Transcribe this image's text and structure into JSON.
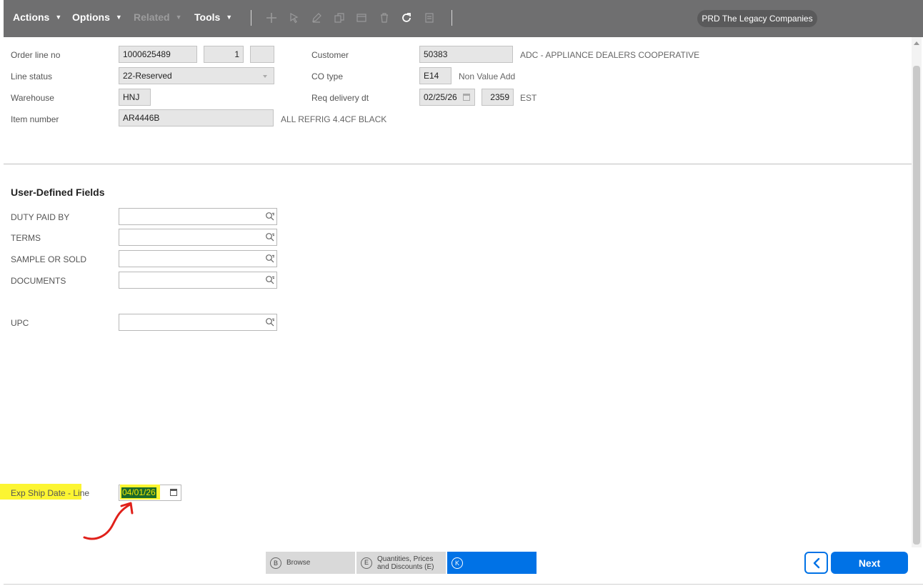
{
  "toolbar": {
    "actions": "Actions",
    "options": "Options",
    "related": "Related",
    "tools": "Tools",
    "company": "PRD The Legacy Companies",
    "icons": [
      "add-icon",
      "select-icon",
      "edit-icon",
      "copy-icon",
      "save-icon",
      "delete-icon",
      "refresh-icon",
      "notes-icon"
    ]
  },
  "header": {
    "order_line_label": "Order line no",
    "order_no": "1000625489",
    "line_no": "1",
    "sub_line": "",
    "line_status_label": "Line status",
    "line_status": "22-Reserved",
    "warehouse_label": "Warehouse",
    "warehouse": "HNJ",
    "item_label": "Item number",
    "item": "AR4446B",
    "item_desc": "ALL REFRIG 4.4CF BLACK",
    "customer_label": "Customer",
    "customer": "50383",
    "customer_name": "ADC - APPLIANCE DEALERS COOPERATIVE",
    "co_type_label": "CO type",
    "co_type": "E14",
    "co_type_desc": "Non Value Add",
    "req_label": "Req delivery dt",
    "req_date": "02/25/26",
    "req_time": "2359",
    "req_tz": "EST"
  },
  "udf": {
    "title": "User-Defined Fields",
    "fields": [
      {
        "label": "DUTY PAID BY",
        "value": ""
      },
      {
        "label": "TERMS",
        "value": ""
      },
      {
        "label": "SAMPLE OR SOLD",
        "value": ""
      },
      {
        "label": "DOCUMENTS",
        "value": ""
      },
      {
        "label": "UPC",
        "value": ""
      }
    ]
  },
  "exp_ship": {
    "label": "Exp Ship Date - Line",
    "value": "04/01/26"
  },
  "tabs": [
    {
      "key": "B",
      "label": "Browse"
    },
    {
      "key": "E",
      "label": "Quantities, Prices and Discounts (E)"
    },
    {
      "key": "K",
      "label": ""
    }
  ],
  "buttons": {
    "next": "Next"
  },
  "colors": {
    "accent": "#0072e6",
    "toolbar": "#6f6f70",
    "highlight": "#fcf532",
    "annotation": "#e0201a"
  }
}
